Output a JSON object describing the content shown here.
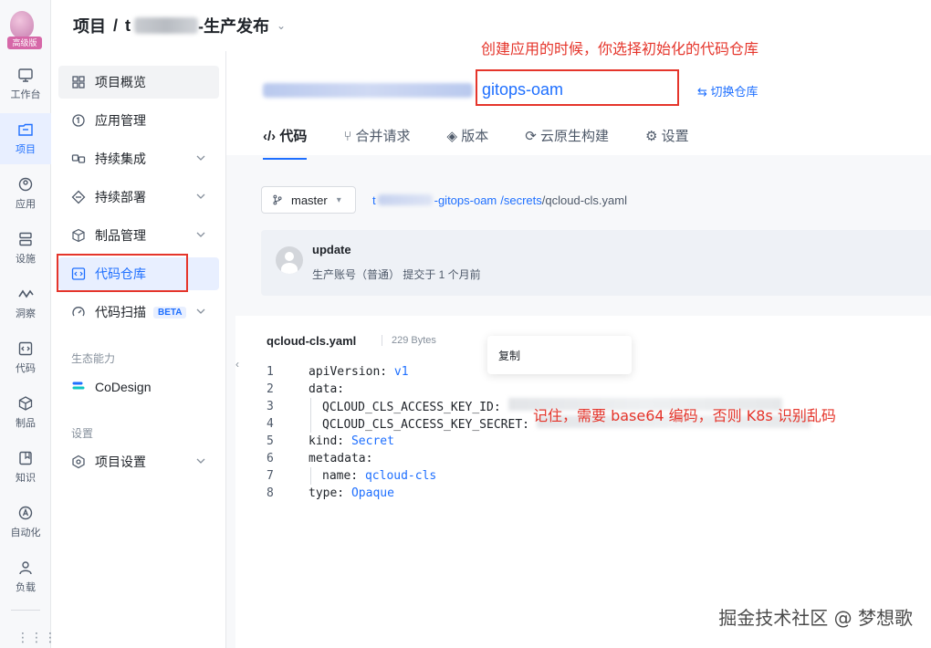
{
  "rail": {
    "badge": "高级版",
    "items": [
      {
        "label": "工作台",
        "icon": "monitor-icon"
      },
      {
        "label": "项目",
        "icon": "project-icon",
        "active": true
      },
      {
        "label": "应用",
        "icon": "app-icon"
      },
      {
        "label": "设施",
        "icon": "server-icon"
      },
      {
        "label": "洞察",
        "icon": "insight-icon"
      },
      {
        "label": "代码",
        "icon": "code-icon"
      },
      {
        "label": "制品",
        "icon": "cube-icon"
      },
      {
        "label": "知识",
        "icon": "book-icon"
      },
      {
        "label": "自动化",
        "icon": "automation-icon"
      },
      {
        "label": "负载",
        "icon": "user-load-icon"
      }
    ],
    "more": "⋮⋮⋮"
  },
  "breadcrumb": {
    "root": "项目",
    "sep": "/",
    "project_prefix": "t",
    "project_suffix": "-生产发布",
    "chevron": "⌄"
  },
  "subnav": {
    "items": [
      {
        "label": "项目概览",
        "icon": "overview-icon"
      },
      {
        "label": "应用管理",
        "icon": "app-manage-icon"
      },
      {
        "label": "持续集成",
        "icon": "ci-icon",
        "expandable": true
      },
      {
        "label": "持续部署",
        "icon": "cd-icon",
        "expandable": true
      },
      {
        "label": "制品管理",
        "icon": "artifact-icon",
        "expandable": true
      },
      {
        "label": "代码仓库",
        "icon": "repo-icon",
        "active": true
      },
      {
        "label": "代码扫描",
        "icon": "scan-icon",
        "expandable": true,
        "badge": "BETA"
      }
    ],
    "group_eco": "生态能力",
    "codesign": "CoDesign",
    "group_settings": "设置",
    "project_settings": "项目设置"
  },
  "repo": {
    "name": "gitops-oam",
    "switch_label": "⇆ 切换仓库",
    "tabs": [
      {
        "label": "‹/› 代码",
        "active": true
      },
      {
        "label": "⑂ 合并请求"
      },
      {
        "label": "◈ 版本"
      },
      {
        "label": "⟳ 云原生构建"
      },
      {
        "label": "⚙ 设置"
      }
    ]
  },
  "branch": {
    "name": "master",
    "caret": "▾"
  },
  "file_path": {
    "prefix": "t",
    "repo_suffix": "-gitops-oam",
    "dir": "/secrets",
    "sep": "/",
    "file": "qcloud-cls.yaml"
  },
  "commit": {
    "message": "update",
    "meta": "生产账号（普通）  提交于 1 个月前"
  },
  "file": {
    "name": "qcloud-cls.yaml",
    "size": "229 Bytes",
    "copy_label": "复制",
    "lines": [
      {
        "n": "1",
        "key": "apiVersion:",
        "val": " v1"
      },
      {
        "n": "2",
        "key": "data:",
        "val": ""
      },
      {
        "n": "3",
        "key": "QCLOUD_CLS_ACCESS_KEY_ID:",
        "val": "",
        "indent": true,
        "redacted": true
      },
      {
        "n": "4",
        "key": "QCLOUD_CLS_ACCESS_KEY_SECRET:",
        "val": "",
        "indent": true,
        "redacted": true
      },
      {
        "n": "5",
        "key": "kind:",
        "val": " Secret"
      },
      {
        "n": "6",
        "key": "metadata:",
        "val": ""
      },
      {
        "n": "7",
        "key": "name:",
        "val": " qcloud-cls",
        "indent": true
      },
      {
        "n": "8",
        "key": "type:",
        "val": " Opaque"
      }
    ]
  },
  "annotations": {
    "top": "创建应用的时候，你选择初始化的代码仓库",
    "code": "记住，需要 base64 编码，否则 K8s 识别乱码",
    "color": "#e5352b"
  },
  "watermark": "掘金技术社区 @ 梦想歌"
}
